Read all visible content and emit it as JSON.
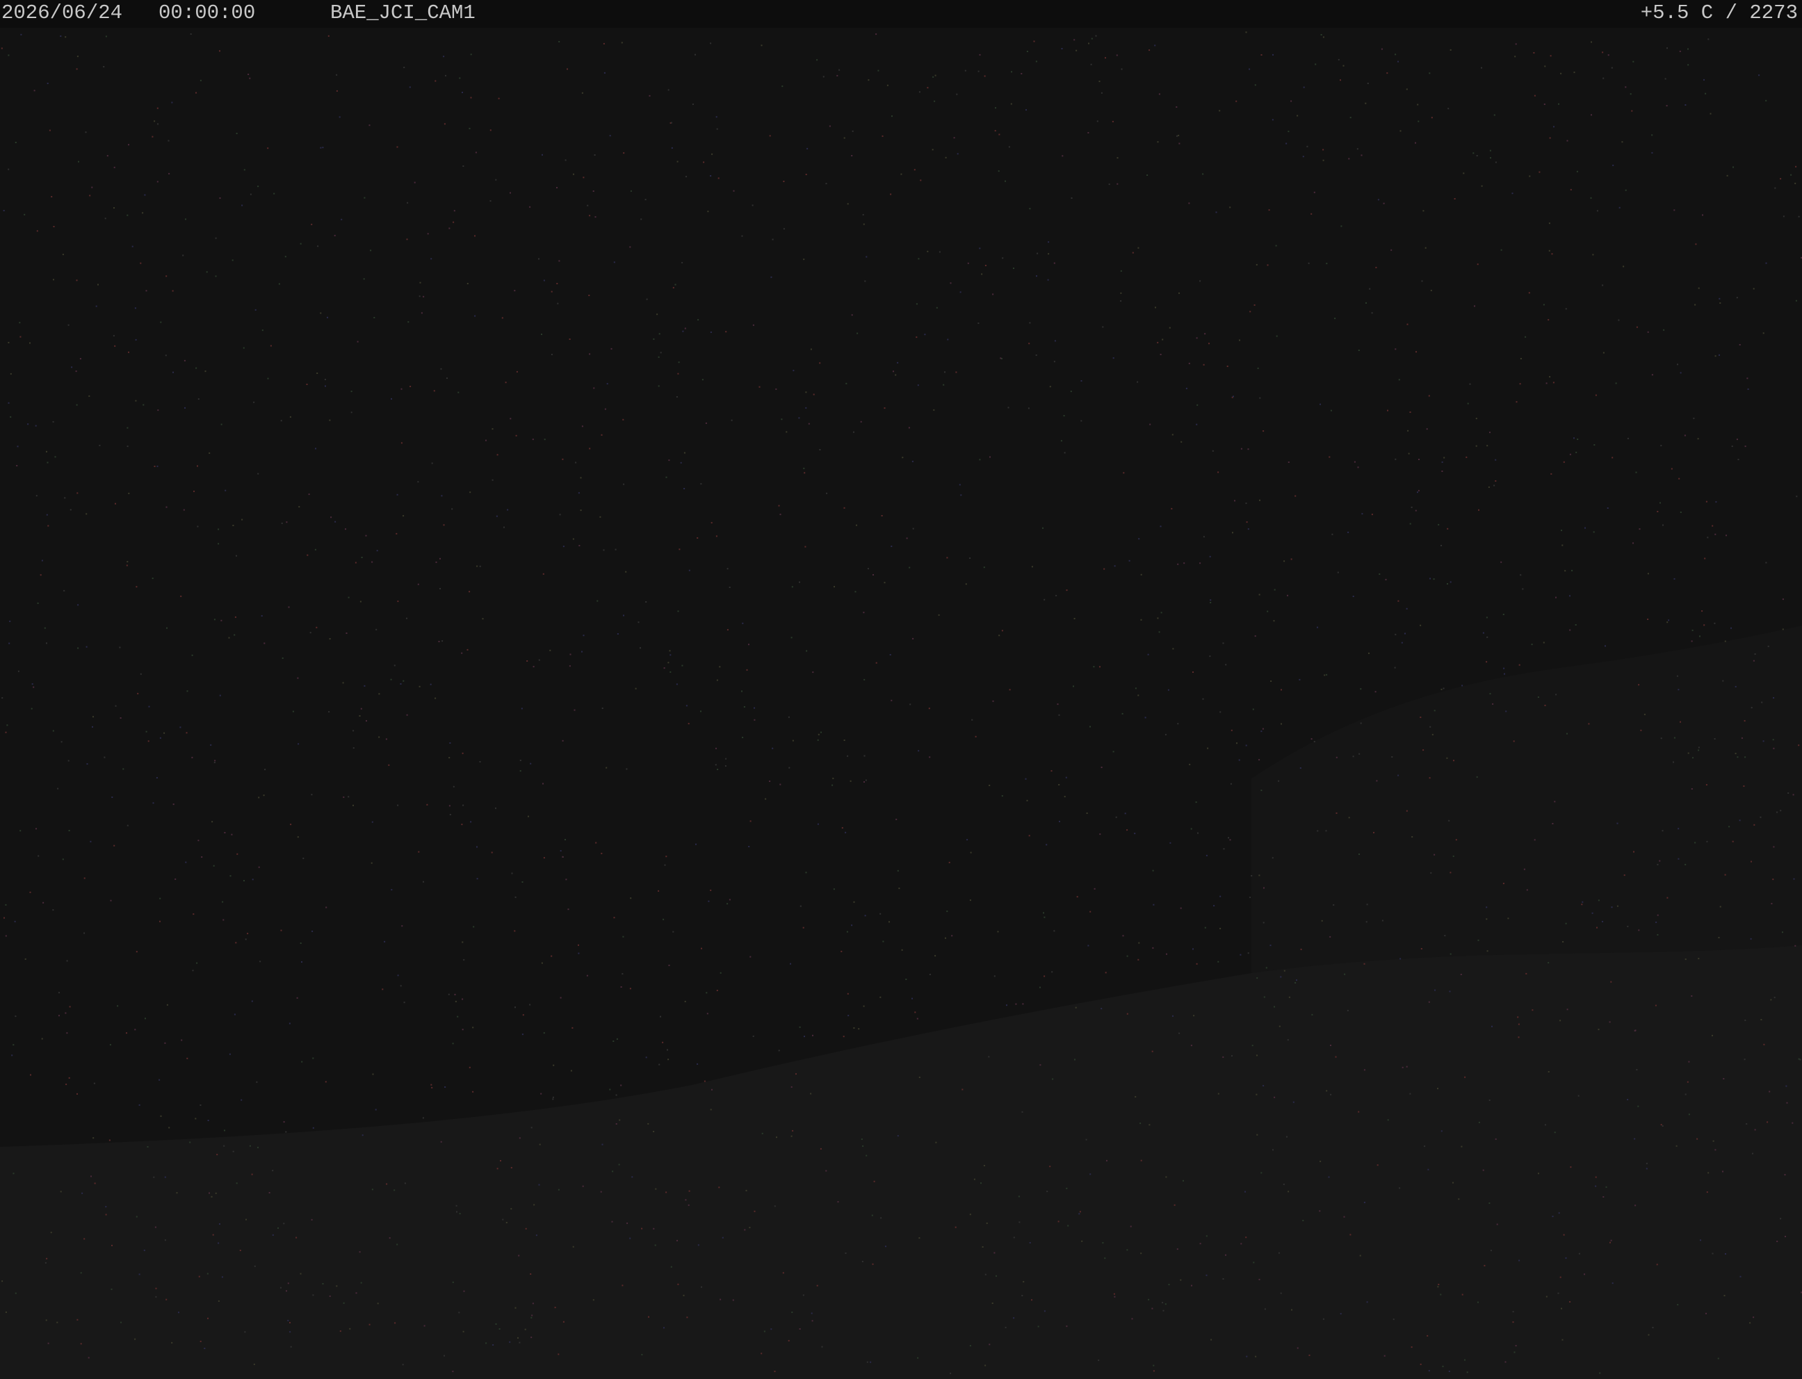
{
  "overlay": {
    "date": "2026/06/24",
    "time": "00:00:00",
    "camera_id": "BAE_JCI_CAM1",
    "temperature": "+5.5 C",
    "separator": "/",
    "altitude": "2273"
  },
  "colors": {
    "background": "#131313",
    "sky": "#121212",
    "ground": "#171717",
    "overlay_text": "#c8c8c8"
  }
}
